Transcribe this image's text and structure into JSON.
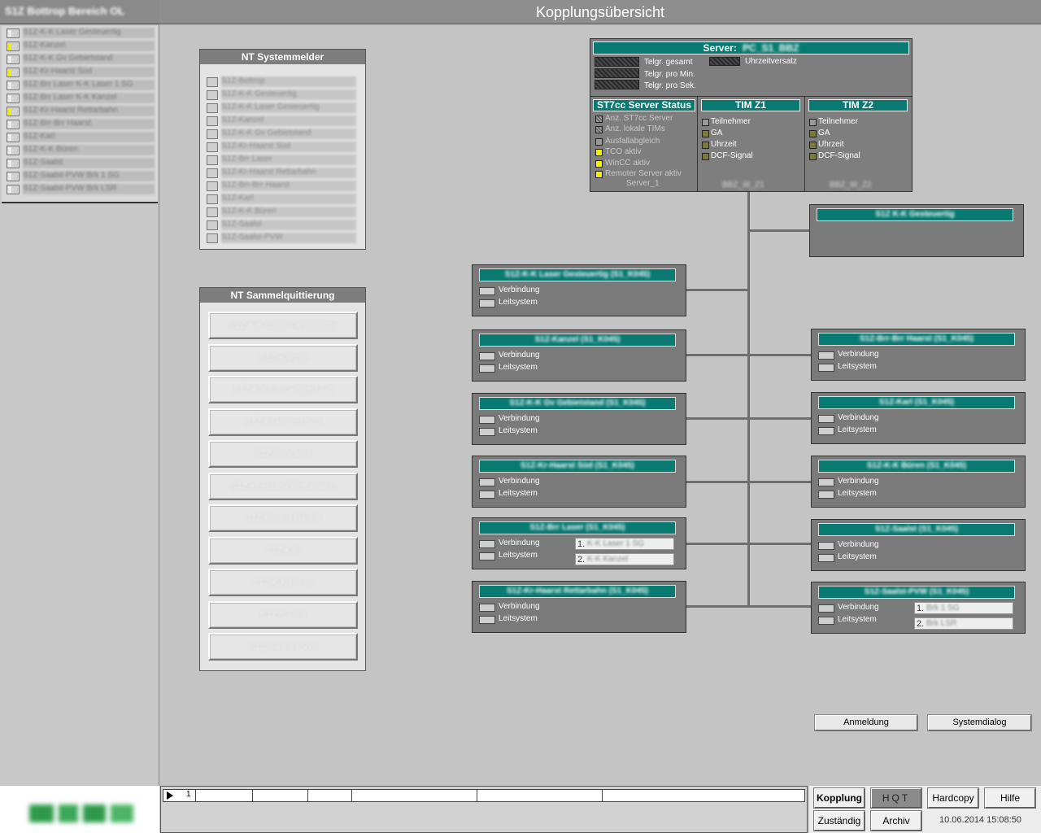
{
  "header": {
    "title": "Kopplungsübersicht"
  },
  "sidebar": {
    "title": "S1Z Bottrop Bereich OL",
    "items": [
      {
        "label": "S1Z-K-K Laser Gesteuertig",
        "on": false
      },
      {
        "label": "S1Z-Kanzel",
        "on": true
      },
      {
        "label": "S1Z-K-K Gv Gebietstand",
        "on": false
      },
      {
        "label": "S1Z-Kr-Haarst Süd",
        "on": true
      },
      {
        "label": "S1Z-Brr Laser K-K Laser 1 SG",
        "on": false
      },
      {
        "label": "S1Z-Brr Laser K-K Kanzel",
        "on": false
      },
      {
        "label": "S1Z-Kr-Haarst Rettarbahn",
        "on": true
      },
      {
        "label": "S1Z-Brr-Brr Haarst",
        "on": false
      },
      {
        "label": "S1Z-Karl",
        "on": false
      },
      {
        "label": "S1Z-K-K Büren",
        "on": false
      },
      {
        "label": "S1Z-Saalst",
        "on": false
      },
      {
        "label": "S1Z-Saalst-PVW Brk 1 SG",
        "on": false
      },
      {
        "label": "S1Z-Saalst-PVW Brk LSR",
        "on": false
      }
    ]
  },
  "nt_systemmelder": {
    "title": "NT Systemmelder",
    "items": [
      "S1Z-Bottrop",
      "S1Z-K-K Gesteuertig",
      "S1Z-K-K Laser Gesteuertig",
      "S1Z-Kanzel",
      "S1Z-K-K Gv Gebietstand",
      "S1Z-Kr-Haarst Süd",
      "S1Z-Brr Laser",
      "S1Z-Kr-Haarst Rettarbahn",
      "S1Z-Brr-Brr Haarst",
      "S1Z-Karl",
      "S1Z-K-K Büren",
      "S1Z-Saalst",
      "S1Z-Saalst-PVW"
    ]
  },
  "nt_sammel": {
    "title": "NT Sammelquittierung",
    "buttons": [
      "S1Z-K-K Laser Gesteuertig",
      "S1Z-Kanzel",
      "S1Z-K-K Gv Gebietstand",
      "S1Z-Kr-Haarst Süd",
      "S1Z-Brr Laser",
      "S1Z-Kr-Haarst Rettarbahn",
      "S1Z-Brr-Brr Haarst",
      "S1Z-Karl",
      "S1Z-K-K Büren",
      "S1Z-Saalst",
      "S1Z-Saalst-PVW"
    ]
  },
  "server": {
    "title_prefix": "Server:",
    "name": "PC_S1_BBZ",
    "telegram_labels": [
      "Telgr. gesamt",
      "Telgr. pro Min.",
      "Telgr. pro Sek."
    ],
    "time_offset_label": "Uhrzeitversatz",
    "st7cc": {
      "title": "ST7cc Server Status",
      "rows": [
        {
          "label": "Anz. ST7cc Server",
          "state": "hatch"
        },
        {
          "label": "Anz. lokale TIMs",
          "state": "hatch"
        },
        {
          "label": "Ausfallabgleich",
          "state": "grey"
        },
        {
          "label": "TCO aktiv",
          "state": "yellow"
        },
        {
          "label": "WinCC aktiv",
          "state": "yellow"
        },
        {
          "label": "Remoter Server aktiv",
          "state": "yellow"
        }
      ],
      "footer": "Server_1"
    },
    "tims": [
      {
        "title": "TIM Z1",
        "rows": [
          "Teilnehmer",
          "GA",
          "Uhrzeit",
          "DCF-Signal"
        ],
        "footer": "BBZ_W_Z1"
      },
      {
        "title": "TIM Z2",
        "rows": [
          "Teilnehmer",
          "GA",
          "Uhrzeit",
          "DCF-Signal"
        ],
        "footer": "BBZ_W_Z2"
      }
    ]
  },
  "connections": {
    "verbindung_label": "Verbindung",
    "leitsystem_label": "Leitsystem",
    "top_right_name": "S1Z K-K Gesteuertig",
    "left": [
      {
        "name": "S1Z-K-K Laser Gesteuertig (S1_K045)"
      },
      {
        "name": "S1Z-Kanzel (S1_K045)"
      },
      {
        "name": "S1Z-K-K Gv Gebietstand (S1_K045)"
      },
      {
        "name": "S1Z-Kr-Haarst Süd (S1_K045)"
      },
      {
        "name": "S1Z-Brr Laser (S1_K045)",
        "slots": [
          "K-K Laser 1 SG",
          "K-K Kanzel"
        ]
      },
      {
        "name": "S1Z-Kr-Haarst Rettarbahn (S1_K045)"
      }
    ],
    "right": [
      {
        "name": "S1Z-Brr-Brr Haarst (S1_K045)"
      },
      {
        "name": "S1Z-Karl (S1_K045)"
      },
      {
        "name": "S1Z-K-K Büren (S1_K045)"
      },
      {
        "name": "S1Z-Saalst (S1_K045)"
      },
      {
        "name": "S1Z-Saalst-PVW (S1_K045)",
        "slots": [
          "Brk 1 SG",
          "Brk LSR"
        ]
      }
    ]
  },
  "actions": {
    "anmeldung": "Anmeldung",
    "systemdialog": "Systemdialog"
  },
  "alarm": {
    "page_number": "1"
  },
  "nav": {
    "kopplung": "Kopplung",
    "hqt": "HQT",
    "hardcopy": "Hardcopy",
    "hilfe": "Hilfe",
    "zustaendig": "Zuständig",
    "archiv": "Archiv",
    "datetime": "10.06.2014 15:08:50"
  },
  "colors": {
    "teal": "#087a72",
    "yellow": "#f4f000",
    "panel": "#7a7a7a"
  }
}
